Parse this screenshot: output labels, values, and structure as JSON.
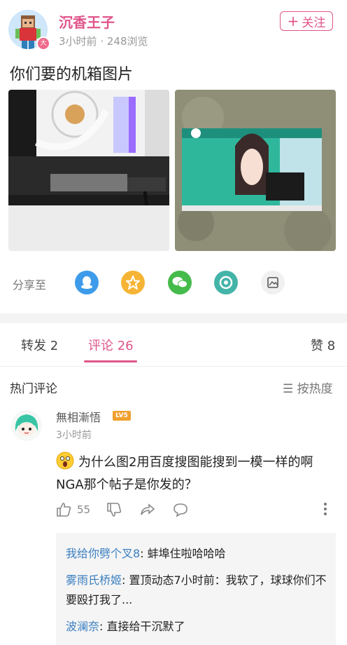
{
  "post": {
    "author": "沉香王子",
    "author_badge": "大",
    "time": "3小时前",
    "views": "248浏览",
    "follow_label": "关注",
    "title": "你们要的机箱图片"
  },
  "share": {
    "label": "分享至",
    "icons": [
      "qq-icon",
      "qzone-star-icon",
      "wechat-icon",
      "moments-icon",
      "gallery-icon"
    ]
  },
  "tabs": {
    "repost": "转发 2",
    "comments": "评论 26",
    "likes": "赞 8"
  },
  "comments_section": {
    "hot_label": "热门评论",
    "sort_label": "按热度"
  },
  "comment": {
    "user": "無相漸悟",
    "level": "LV5",
    "time": "3小时前",
    "text": "为什么图2用百度搜图能搜到一模一样的啊 NGA那个帖子是你发的？",
    "like_count": "55",
    "replies": [
      {
        "who": "我给你劈个叉8",
        "text": ": 蚌埠住啦哈哈哈"
      },
      {
        "who": "雾雨氏桥姬",
        "text": ": 置顶动态7小时前：我软了，球球你们不要殴打我了..."
      },
      {
        "who": "波澜奈",
        "text": ": 直接给干沉默了"
      }
    ]
  },
  "colors": {
    "accent": "#e0558a",
    "link": "#3a7fc0",
    "qq": "#3d9bea",
    "star": "#f6b435",
    "wechat": "#44bb4a",
    "moments": "#44b4a8"
  }
}
